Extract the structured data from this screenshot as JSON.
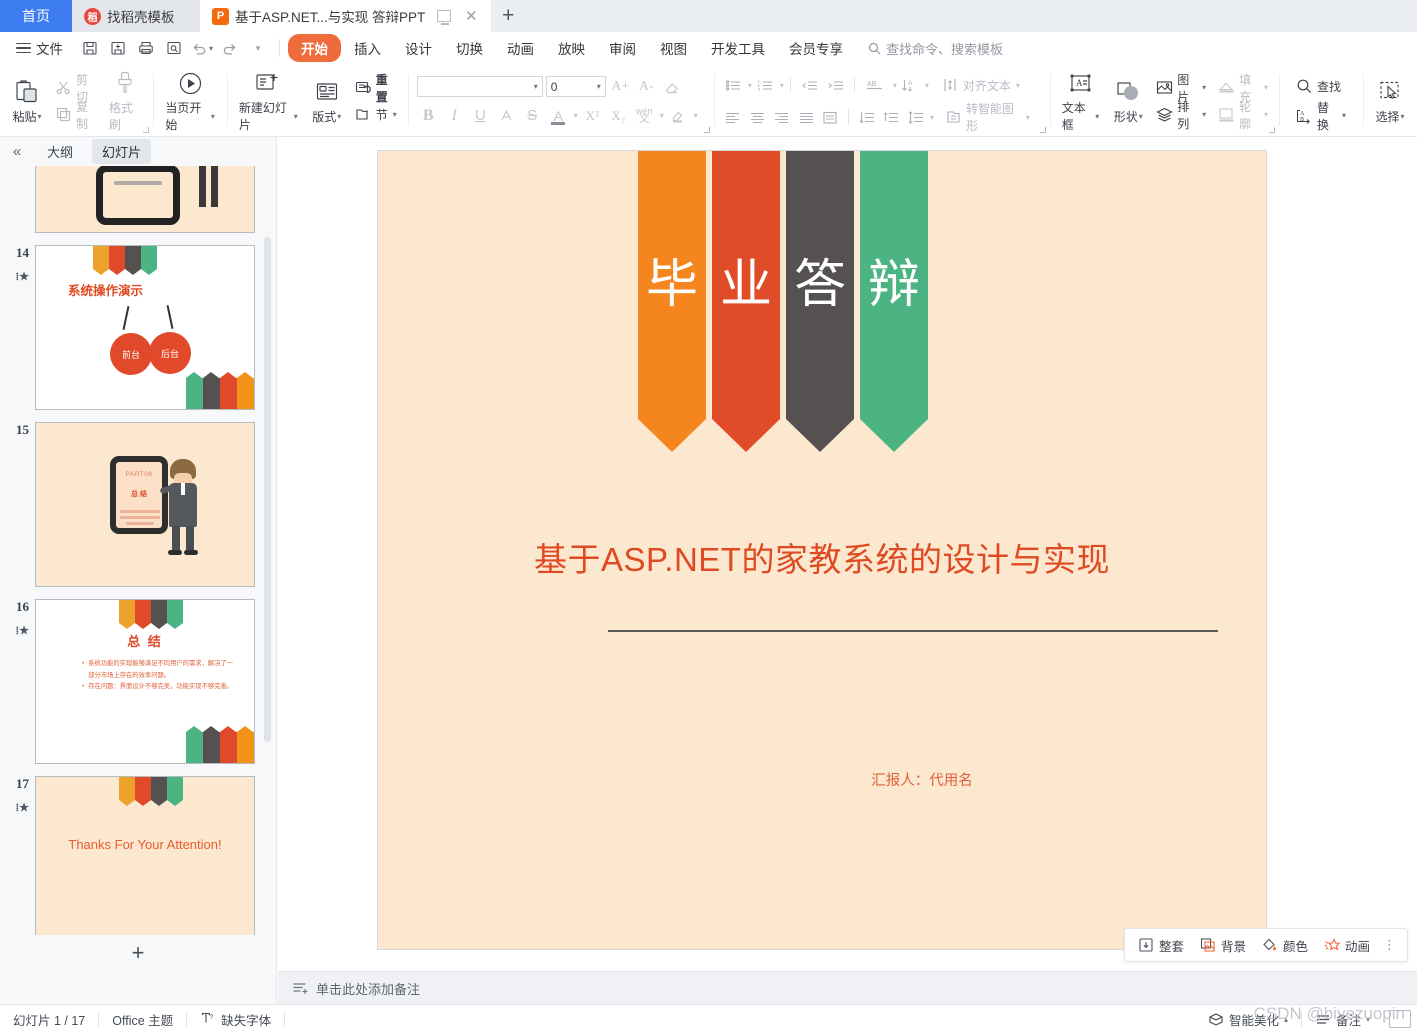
{
  "tabbar": {
    "home_tab": "首页",
    "template_tab": "找稻壳模板",
    "doc_tab": "基于ASP.NET...与实现 答辩PPT",
    "new_tab_label": "+",
    "close_label": "✕",
    "ppt_icon_letter": "P"
  },
  "menubar": {
    "file": "文件",
    "tabs": [
      "开始",
      "插入",
      "设计",
      "切换",
      "动画",
      "放映",
      "审阅",
      "视图",
      "开发工具",
      "会员专享"
    ],
    "selected_tab": "开始",
    "search_placeholder": "查找命令、搜索模板"
  },
  "ribbon": {
    "clipboard": {
      "paste": "粘贴",
      "cut": "剪切",
      "copy": "复制",
      "format_painter": "格式刷"
    },
    "present": {
      "from_current": "当页开始"
    },
    "slides": {
      "new_slide": "新建幻灯片",
      "layout": "版式",
      "reset": "重置",
      "section": "节"
    },
    "font": {
      "font_name": "",
      "font_size": "0",
      "grow": "A+",
      "shrink": "A-",
      "clear_format": "清除格式",
      "bold": "B",
      "italic": "I",
      "underline": "U",
      "text_effect": "A",
      "strikethrough": "S",
      "font_color": "A",
      "superscript": "X²",
      "subscript": "X₂",
      "phonetic": "wén",
      "highlight": "highlight"
    },
    "paragraph": {
      "bullets": "项目符号",
      "numbering": "编号",
      "decrease_indent": "减少缩进",
      "increase_indent": "增加缩进",
      "text_direction": "AB",
      "sort": "排序",
      "align_text": "对齐文本",
      "align_left": "左对齐",
      "align_center": "居中",
      "align_right": "右对齐",
      "justify": "两端对齐",
      "distribute": "分散对齐",
      "line_spacing": "行距",
      "para_spacing": "段落间距",
      "line_spacing2": "行间距",
      "smart_art": "转智能图形"
    },
    "insert": {
      "text_box": "文本框",
      "shape": "形状",
      "picture": "图片",
      "arrange": "排列",
      "fill": "填充",
      "outline": "轮廓"
    },
    "editing": {
      "find": "查找",
      "replace": "替换",
      "select": "选择"
    }
  },
  "leftpane": {
    "collapse_icon": "«",
    "tabs": [
      "大纲",
      "幻灯片"
    ],
    "selected_tab": "幻灯片",
    "add_slide": "+",
    "slides": [
      {
        "number": "",
        "type": "partial-cream",
        "star": false
      },
      {
        "number": "14",
        "type": "demo",
        "star": true,
        "title": "系统操作演示",
        "circle1": "前台",
        "circle2": "后台"
      },
      {
        "number": "15",
        "type": "part06",
        "star": false,
        "part": "PART06",
        "heading": "总  结"
      },
      {
        "number": "16",
        "type": "summary",
        "star": true,
        "heading": "总      结",
        "bullets": [
          "系统功能的实现能够满足不同用户的需求，解决了一部分市场上存在的效率问题。",
          "存在问题：界面设计不够完美，功能实现不够完善。"
        ]
      },
      {
        "number": "17",
        "type": "thanks",
        "star": true,
        "text": "Thanks For Your Attention!"
      }
    ]
  },
  "slide": {
    "banner_chars": [
      "毕",
      "业",
      "答",
      "辩"
    ],
    "banner_colors": [
      "#f5861f",
      "#e04b28",
      "#545150",
      "#4cb383"
    ],
    "title": "基于ASP.NET的家教系统的设计与实现",
    "presenter": "汇报人：代用名",
    "background_color": "#fbe8cf",
    "title_color": "#e04a22"
  },
  "design_toolbar": {
    "whole_set": "整套",
    "background": "背景",
    "color": "颜色",
    "animation": "动画",
    "more": "⋮"
  },
  "notes": {
    "placeholder": "单击此处添加备注"
  },
  "statusbar": {
    "slide_counter": "幻灯片 1 / 17",
    "theme": "Office 主题",
    "missing_font": "缺失字体",
    "smart_beautify": "智能美化",
    "notes_toggle": "备注",
    "watermark": "CSDN @biyezuopin"
  },
  "colors": {
    "accent_orange": "#ef6b3c",
    "tab_blue": "#3c7bf0",
    "brand_red": "#e04a22",
    "cream": "#fbe8cf",
    "green": "#4cb383",
    "dark_gray": "#545150",
    "yellow": "#eda22c"
  }
}
